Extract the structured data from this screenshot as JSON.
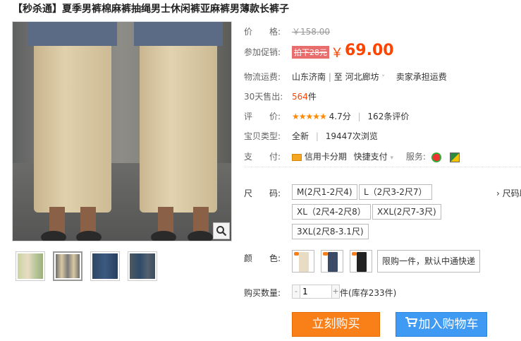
{
  "product": {
    "title": "【秒杀通】夏季男裤棉麻裤抽绳男士休闲裤亚麻裤男薄款长裤子"
  },
  "price": {
    "label": "价　　格:",
    "original": "￥158.00",
    "promo_label": "参加促销:",
    "promo_tag": "拍下28元",
    "yen": "￥",
    "current": "69.00"
  },
  "shipping": {
    "label": "物流运费:",
    "from": "山东济南",
    "to_sep": "至",
    "to": "河北廊坊",
    "to_arrow": "˅",
    "note": "卖家承担运费"
  },
  "sales": {
    "label": "30天售出:",
    "count": "564",
    "unit": "件"
  },
  "rating": {
    "label": "评　　价:",
    "stars": "★★★★★",
    "score": "4.7分",
    "sep": "|",
    "reviews": "162条评价"
  },
  "item_type": {
    "label": "宝贝类型:",
    "type": "全新",
    "sep": "|",
    "views": "19447次浏览"
  },
  "payment": {
    "label": "支　　付:",
    "credit": "信用卡分期",
    "quick": "快捷支付",
    "service_label": "服务:"
  },
  "size": {
    "label": "尺　　码:",
    "options": [
      "M(2尺1-2尺4)",
      "L（2尺3-2尺7）",
      "XL（2尺4-2尺8）",
      "XXL(2尺7-3尺)",
      "3XL(2尺8-3.1尺)"
    ],
    "chart_link": "› 尺码助"
  },
  "color": {
    "label": "颜　　色:",
    "note": "限购一件，默认中通快递"
  },
  "quantity": {
    "label": "购买数量:",
    "minus": "-",
    "value": "1",
    "plus": "+",
    "unit": "件",
    "stock": "(库存233件)"
  },
  "actions": {
    "buy": "立刻购买",
    "cart": "加入购物车"
  },
  "colors": {
    "accent_orange": "#f97f19",
    "price_red": "#ff4400",
    "cart_blue": "#3f9af3",
    "swatch_beige": "#e8dcc4",
    "swatch_navy": "#3b4a66",
    "swatch_black": "#222222"
  }
}
